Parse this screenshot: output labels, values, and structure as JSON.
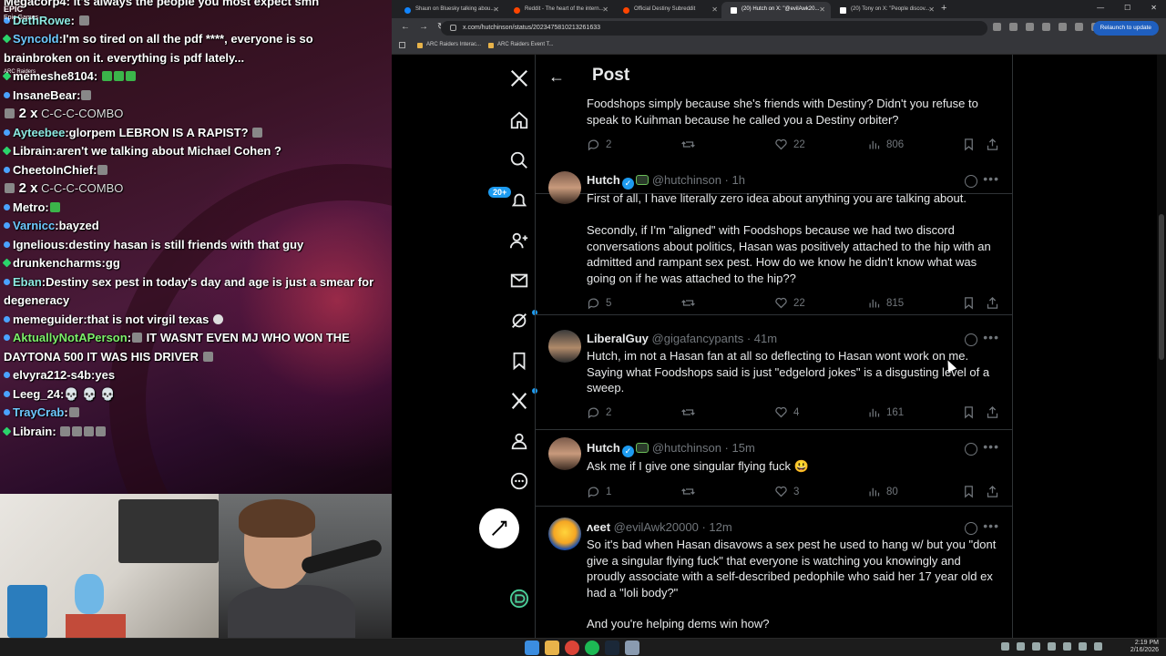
{
  "chat": {
    "lines": [
      {
        "user": "",
        "text": "Megacorp4: it's always the people you most expect smh",
        "kind": "partial"
      },
      {
        "user": "DethRowe",
        "text": ""
      },
      {
        "user": "Syncold",
        "text": "I'm so tired on all the pdf ****, everyone is so brainbroken on it. everything is pdf lately..."
      },
      {
        "user": "memeshe8104",
        "text": ""
      },
      {
        "user": "InsaneBear",
        "text": ""
      },
      {
        "combo_count": "2 x",
        "combo_label": "C-C-C-COMBO"
      },
      {
        "user": "Ayteebee",
        "text": "glorpem LEBRON IS A RAPIST?"
      },
      {
        "user": "Librain",
        "text": "aren't we talking about Michael Cohen ?"
      },
      {
        "user": "CheetoInChief",
        "text": ""
      },
      {
        "combo_count": "2 x",
        "combo_label": "C-C-C-COMBO"
      },
      {
        "user": "Metro",
        "text": ""
      },
      {
        "user": "Varnicc",
        "text": "bayzed"
      },
      {
        "user": "Ignelious",
        "text": "destiny hasan is still friends with that guy"
      },
      {
        "user": "drunkencharms",
        "text": "gg"
      },
      {
        "user": "Eban",
        "text": "Destiny sex pest in today's day and age is just a smear for degeneracy"
      },
      {
        "user": "memeguider",
        "text": "that is not virgil texas"
      },
      {
        "user": "AktuallyNotAPerson",
        "text": "IT WASNT EVEN MJ WHO WON THE DAYTONA 500 IT WAS HIS DRIVER"
      },
      {
        "user": "elvyra212-s4b",
        "text": "yes"
      },
      {
        "user": "Leeg_24",
        "text": "💀 💀 💀"
      },
      {
        "user": "TrayCrab",
        "text": ""
      },
      {
        "user": "Librain",
        "text": ""
      }
    ],
    "overlay_logo": "EPIC",
    "overlay_sub1": "Epic Games",
    "overlay_sub2": "ARC Raiders"
  },
  "browser": {
    "tabs": [
      {
        "label": "Shaun on Bluesky talking abou...",
        "color": "#1185fe"
      },
      {
        "label": "Reddit - The heart of the intern...",
        "color": "#ff4500"
      },
      {
        "label": "Official Destiny Subreddit",
        "color": "#ff4500"
      },
      {
        "label": "(20) Hutch on X: \"@evilAwk20...",
        "color": "#ffffff"
      },
      {
        "label": "(20) Tony on X: \"People discov...",
        "color": "#ffffff"
      }
    ],
    "url": "x.com/hutchinson/status/2023475810213261633",
    "relaunch_label": "Relaunch to update",
    "bookmarks": [
      "ARC Raiders Interac...",
      "ARC Raiders Event T..."
    ]
  },
  "x": {
    "header_title": "Post",
    "notif_badge": "20+",
    "tweets": [
      {
        "name": "",
        "handle": "",
        "time": "",
        "body": "Foodshops simply because she's friends with Destiny? Didn't you refuse to speak to Kuihman because he called you a Destiny orbiter?",
        "replies": "2",
        "retweets": "",
        "likes": "22",
        "views": "806"
      },
      {
        "name": "Hutch",
        "handle": "@hutchinson",
        "time": "· 1h",
        "body": "First of all, I have literally zero idea about anything you are talking about.",
        "body2": "Secondly, if I'm \"aligned\" with Foodshops because we had two discord conversations about politics, Hasan was positively attached to the hip with an admitted and rampant sex pest. How do we know he didn't know what was going on if he was attached to the hip??",
        "replies": "5",
        "retweets": "",
        "likes": "22",
        "views": "815"
      },
      {
        "name": "LiberalGuy",
        "handle": "@gigafancypants",
        "time": "· 41m",
        "body": "Hutch, im not a Hasan fan at all so deflecting to Hasan wont work on me. Saying what Foodshops said is just \"edgelord jokes\" is a disgusting level of a sweep.",
        "replies": "2",
        "retweets": "",
        "likes": "4",
        "views": "161"
      },
      {
        "name": "Hutch",
        "handle": "@hutchinson",
        "time": "· 15m",
        "body": "Ask me if I give one singular flying fuck 😃",
        "replies": "1",
        "retweets": "",
        "likes": "3",
        "views": "80"
      },
      {
        "name": "ʌeet",
        "handle": "@evilAwk20000",
        "time": "· 12m",
        "body": "So it's bad when Hasan disavows a sex pest he used to hang w/ but you \"dont give a singular flying fuck\" that everyone is watching you knowingly and proudly associate with a self-described pedophile who said her 17 year old ex had a \"loli body?\"",
        "body2": "And you're helping dems win how?",
        "replies": "",
        "retweets": "",
        "likes": "",
        "views": ""
      }
    ]
  },
  "taskbar": {
    "time": "2:19 PM",
    "date": "2/16/2026"
  }
}
